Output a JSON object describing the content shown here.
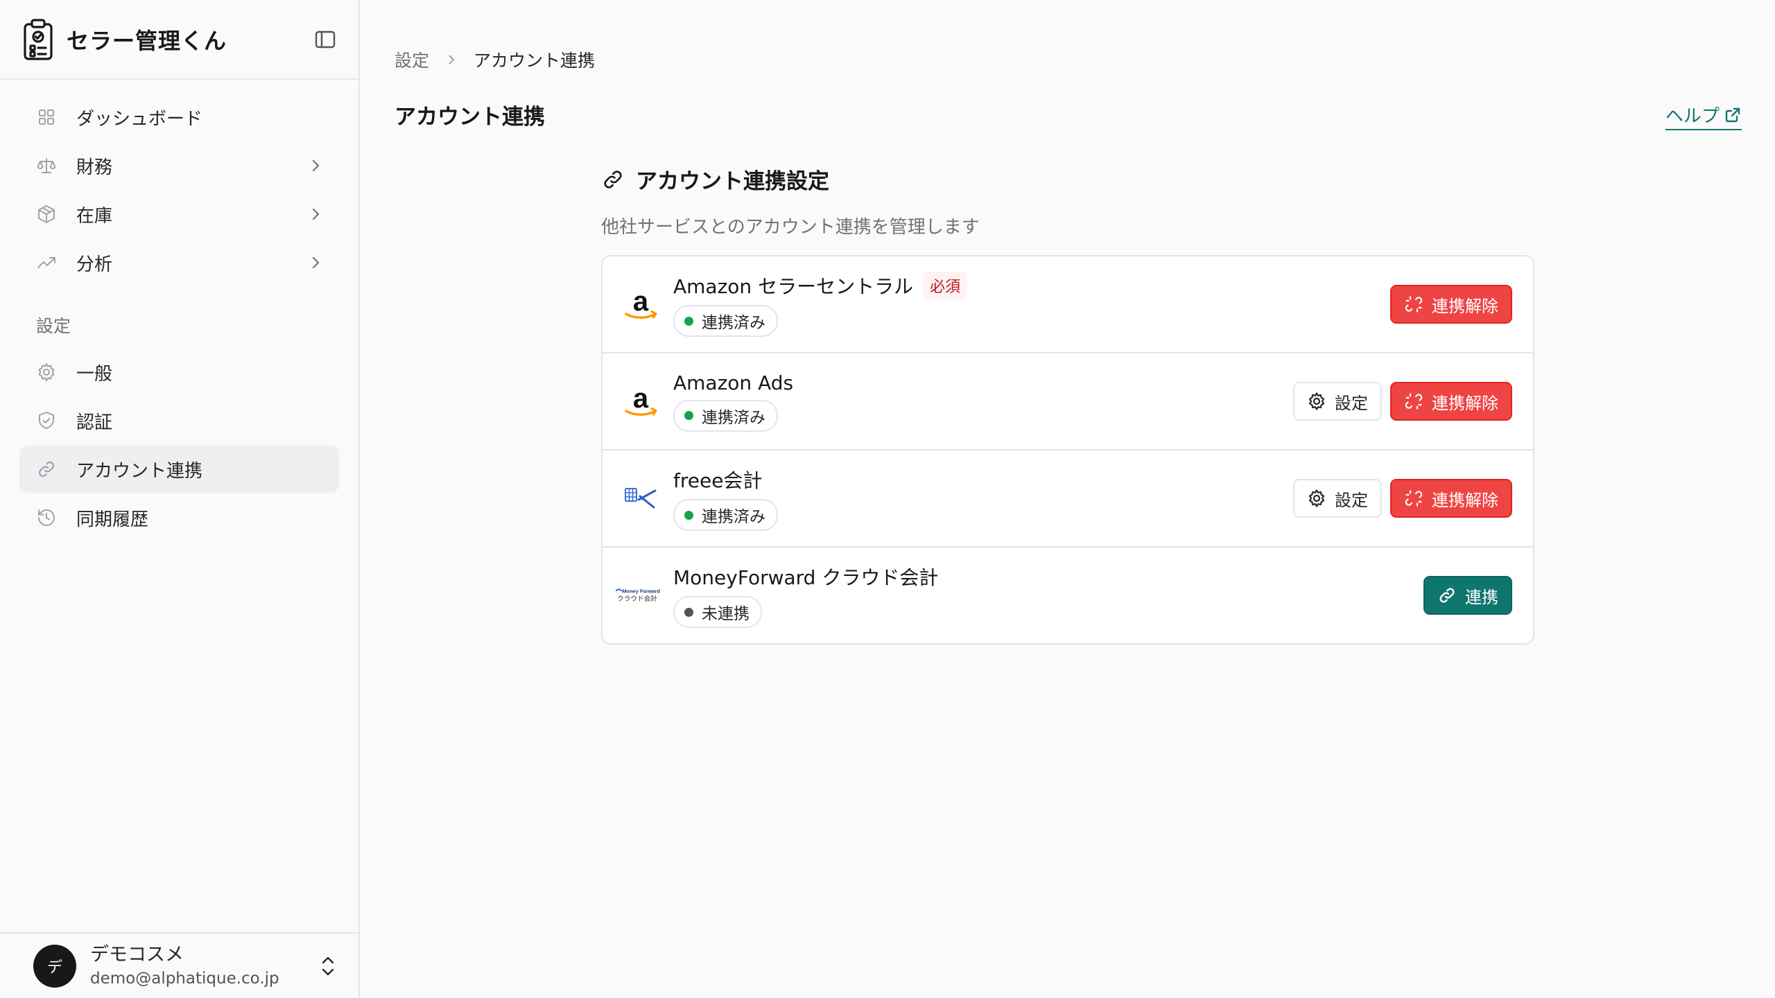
{
  "app": {
    "title": "セラー管理くん"
  },
  "sidebar": {
    "items": [
      {
        "label": "ダッシュボード",
        "icon": "dashboard-icon"
      },
      {
        "label": "財務",
        "icon": "scale-icon",
        "has_children": true
      },
      {
        "label": "在庫",
        "icon": "box-icon",
        "has_children": true
      },
      {
        "label": "分析",
        "icon": "trend-icon",
        "has_children": true
      }
    ],
    "settings_section_label": "設定",
    "settings_items": [
      {
        "label": "一般",
        "icon": "gear-icon"
      },
      {
        "label": "認証",
        "icon": "shield-icon"
      },
      {
        "label": "アカウント連携",
        "icon": "link-icon",
        "active": true
      },
      {
        "label": "同期履歴",
        "icon": "history-icon"
      }
    ],
    "user": {
      "avatar_initial": "デ",
      "name": "デモコスメ",
      "email": "demo@alphatique.co.jp"
    }
  },
  "breadcrumb": {
    "parent": "設定",
    "current": "アカウント連携"
  },
  "page": {
    "title": "アカウント連携",
    "help_label": "ヘルプ"
  },
  "section": {
    "title": "アカウント連携設定",
    "description": "他社サービスとのアカウント連携を管理します"
  },
  "services": [
    {
      "name": "Amazon セラーセントラル",
      "required_label": "必須",
      "status": "連携済み",
      "connected": true,
      "show_settings": false,
      "logo": "amazon-logo"
    },
    {
      "name": "Amazon Ads",
      "status": "連携済み",
      "connected": true,
      "show_settings": true,
      "logo": "amazon-logo"
    },
    {
      "name": "freee会計",
      "status": "連携済み",
      "connected": true,
      "show_settings": true,
      "logo": "freee-logo"
    },
    {
      "name": "MoneyForward クラウド会計",
      "status": "未連携",
      "connected": false,
      "show_settings": false,
      "logo": "moneyforward-logo",
      "logo_text_top": "Money Forward",
      "logo_text_bottom": "クラウド会計"
    }
  ],
  "buttons": {
    "settings": "設定",
    "disconnect": "連携解除",
    "connect": "連携"
  },
  "colors": {
    "accent": "#0f766e",
    "danger": "#ef4444",
    "connected_dot": "#16a34a",
    "disconnected_dot": "#52525b",
    "required_text": "#b91c1c"
  }
}
